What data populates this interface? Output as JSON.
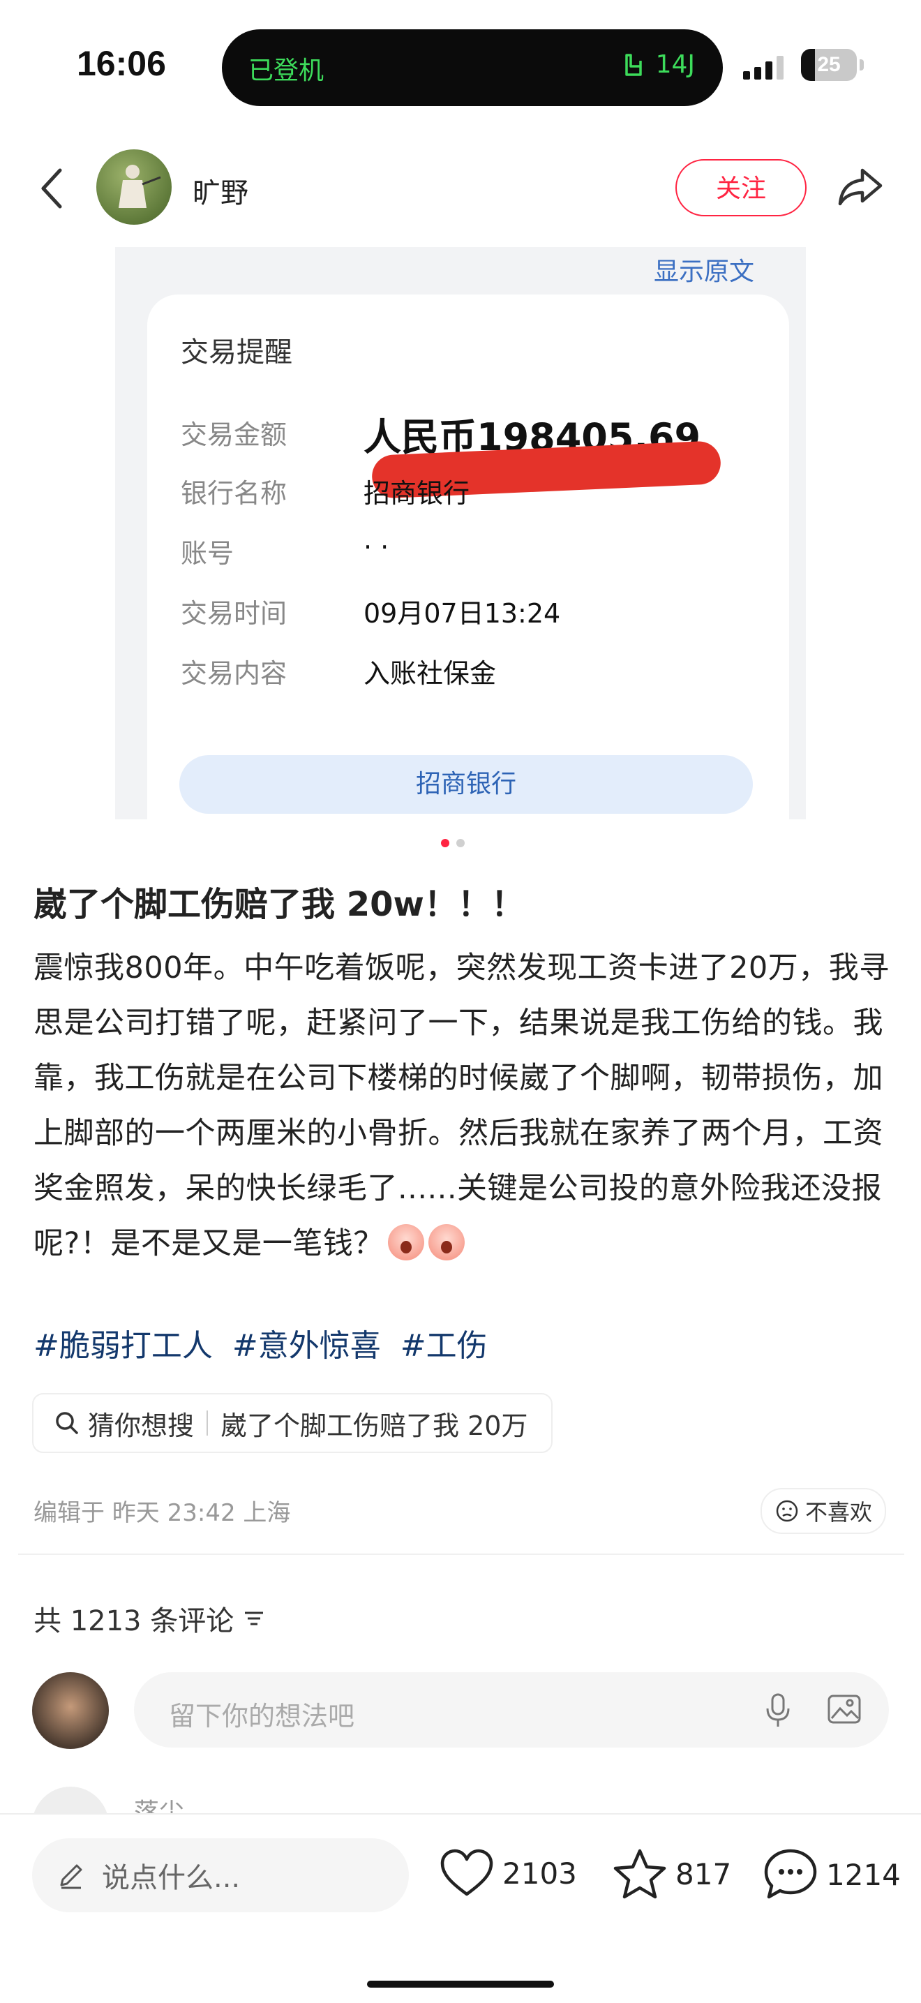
{
  "status_bar": {
    "time": "16:06",
    "island_left": "已登机",
    "island_right": "14J",
    "battery": "25",
    "battery_level": 0.25
  },
  "header": {
    "username": "旷野",
    "follow_label": "关注"
  },
  "image": {
    "show_original": "显示原文",
    "card_title": "交易提醒",
    "rows": [
      {
        "label": "交易金额",
        "value": "人民币198405.69"
      },
      {
        "label": "银行名称",
        "value": "招商银行"
      },
      {
        "label": "账号",
        "value": "·  ·"
      },
      {
        "label": "交易时间",
        "value": "09月07日13:24"
      },
      {
        "label": "交易内容",
        "value": "入账社保金"
      }
    ],
    "bank_button": "招商银行",
    "page_index": 1,
    "page_count": 2
  },
  "post": {
    "title": "崴了个脚工伤赔了我 20w！！！",
    "body": "震惊我800年。中午吃着饭呢，突然发现工资卡进了20万，我寻思是公司打错了呢，赶紧问了一下，结果说是我工伤给的钱。我靠，我工伤就是在公司下楼梯的时候崴了个脚啊，韧带损伤，加上脚部的一个两厘米的小骨折。然后我就在家养了两个月，工资奖金照发，呆的快长绿毛了......关键是公司投的意外险我还没报呢?！是不是又是一笔钱？",
    "tags": [
      "#脆弱打工人",
      "#意外惊喜",
      "#工伤"
    ],
    "guess_label": "猜你想搜",
    "guess_query": "崴了个脚工伤赔了我 20万",
    "meta": "编辑于 昨天 23:42 上海",
    "dislike_label": "不喜欢"
  },
  "comments": {
    "count_label": "共 1213 条评论",
    "input_placeholder": "留下你的想法吧",
    "next_commenter": "落尘"
  },
  "bottom_bar": {
    "say_placeholder": "说点什么...",
    "likes": "2103",
    "favorites": "817",
    "comments": "1214"
  },
  "colors": {
    "accent": "#ff2442",
    "tag": "#13386c",
    "island_text": "#3ddc5b",
    "link": "#3b6fc2"
  }
}
